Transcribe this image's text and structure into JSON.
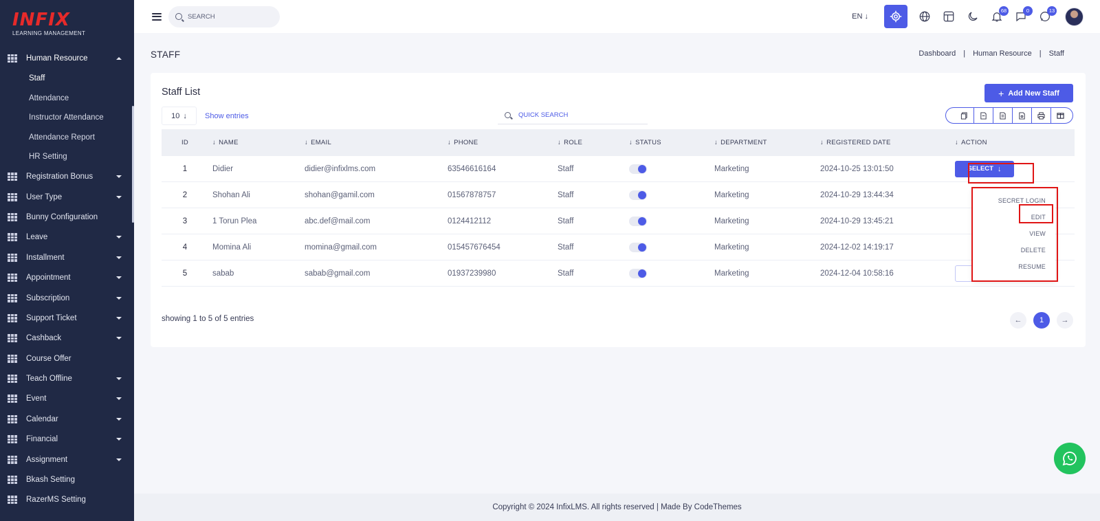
{
  "brand": {
    "logo": "INFIX",
    "tagline": "LEARNING MANAGEMENT"
  },
  "sidebar": {
    "open_menu": {
      "label": "Human Resource",
      "icon": "grid-icon"
    },
    "submenu": [
      {
        "label": "Staff",
        "active": true
      },
      {
        "label": "Attendance"
      },
      {
        "label": "Instructor Attendance"
      },
      {
        "label": "Attendance Report"
      },
      {
        "label": "HR Setting"
      }
    ],
    "items": [
      {
        "label": "Registration Bonus",
        "caret": true
      },
      {
        "label": "User Type",
        "caret": true
      },
      {
        "label": "Bunny Configuration",
        "caret": false
      },
      {
        "label": "Leave",
        "caret": true
      },
      {
        "label": "Installment",
        "caret": true
      },
      {
        "label": "Appointment",
        "caret": true
      },
      {
        "label": "Subscription",
        "caret": true
      },
      {
        "label": "Support Ticket",
        "caret": true
      },
      {
        "label": "Cashback",
        "caret": true
      },
      {
        "label": "Course Offer",
        "caret": false
      },
      {
        "label": "Teach Offline",
        "caret": true
      },
      {
        "label": "Event",
        "caret": true
      },
      {
        "label": "Calendar",
        "caret": true
      },
      {
        "label": "Financial",
        "caret": true
      },
      {
        "label": "Assignment",
        "caret": true
      },
      {
        "label": "Bkash Setting",
        "caret": false
      },
      {
        "label": "RazerMS Setting",
        "caret": false
      }
    ]
  },
  "header": {
    "search_placeholder": "SEARCH",
    "language": "EN",
    "badges": {
      "notifications": "68",
      "messages": "0",
      "chat": "13"
    }
  },
  "page": {
    "title": "STAFF",
    "breadcrumb": [
      "Dashboard",
      "Human Resource",
      "Staff"
    ]
  },
  "card": {
    "title": "Staff List",
    "add_button": "Add New Staff",
    "entries_value": "10",
    "entries_label": "Show entries",
    "quick_search_placeholder": "QUICK SEARCH",
    "export_icons": [
      "copy-icon",
      "csv-icon",
      "excel-icon",
      "pdf-icon",
      "print-icon",
      "columns-icon"
    ]
  },
  "table": {
    "headers": [
      "ID",
      "NAME",
      "EMAIL",
      "PHONE",
      "ROLE",
      "STATUS",
      "DEPARTMENT",
      "REGISTERED DATE",
      "ACTION"
    ],
    "rows": [
      {
        "id": "1",
        "name": "Didier",
        "email": "didier@infixlms.com",
        "phone": "63546616164",
        "role": "Staff",
        "status": true,
        "department": "Marketing",
        "date": "2024-10-25 13:01:50"
      },
      {
        "id": "2",
        "name": "Shohan Ali",
        "email": "shohan@gamil.com",
        "phone": "01567878757",
        "role": "Staff",
        "status": true,
        "department": "Marketing",
        "date": "2024-10-29 13:44:34"
      },
      {
        "id": "3",
        "name": "1 Torun Plea",
        "email": "abc.def@mail.com",
        "phone": "0124412112",
        "role": "Staff",
        "status": true,
        "department": "Marketing",
        "date": "2024-10-29 13:45:21"
      },
      {
        "id": "4",
        "name": "Momina Ali",
        "email": "momina@gmail.com",
        "phone": "015457676454",
        "role": "Staff",
        "status": true,
        "department": "Marketing",
        "date": "2024-12-02 14:19:17"
      },
      {
        "id": "5",
        "name": "sabab",
        "email": "sabab@gmail.com",
        "phone": "01937239980",
        "role": "Staff",
        "status": true,
        "department": "Marketing",
        "date": "2024-12-04 10:58:16"
      }
    ],
    "action_button": "SELECT",
    "dropdown": [
      "SECRET LOGIN",
      "EDIT",
      "VIEW",
      "DELETE",
      "RESUME"
    ]
  },
  "pagination": {
    "showing": "showing 1 to 5 of 5 entries",
    "current": "1"
  },
  "footer": {
    "text": "Copyright © 2024 InfixLMS. All rights reserved | Made By CodeThemes"
  },
  "colors": {
    "primary": "#4d5be6",
    "sidebar": "#202945",
    "highlight": "#e01515",
    "whatsapp": "#22c35e"
  }
}
